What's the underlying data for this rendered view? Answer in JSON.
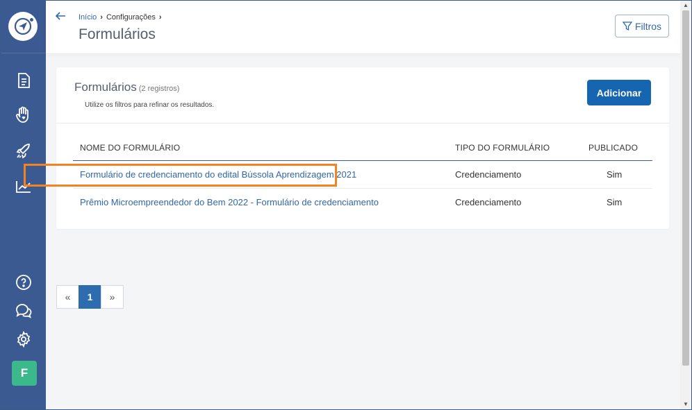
{
  "sidebar": {
    "icons": [
      "compass-logo-icon",
      "document-icon",
      "hand-heart-icon",
      "rocket-icon",
      "chart-icon",
      "help-icon",
      "chat-icon",
      "gear-icon"
    ],
    "avatar_letter": "F",
    "avatar_color": "#3cb98a"
  },
  "header": {
    "breadcrumb": {
      "home": "Início",
      "settings": "Configurações"
    },
    "title": "Formulários",
    "filter_label": "Filtros"
  },
  "card": {
    "title": "Formulários",
    "count": "(2 registros)",
    "subtitle": "Utilize os filtros para refinar os resultados.",
    "add_label": "Adicionar"
  },
  "table": {
    "columns": [
      "NOME DO FORMULÁRIO",
      "TIPO DO FORMULÁRIO",
      "PUBLICADO"
    ],
    "rows": [
      {
        "name": "Formulário de credenciamento do edital Bússola Aprendizagem 2021",
        "type": "Credenciamento",
        "published": "Sim"
      },
      {
        "name": "Prêmio Microempreendedor do Bem 2022 - Formulário de credenciamento",
        "type": "Credenciamento",
        "published": "Sim"
      }
    ]
  },
  "pagination": {
    "prev": "«",
    "current": "1",
    "next": "»"
  },
  "colors": {
    "sidebar": "#3c5a92",
    "accent": "#1565b0",
    "link": "#3167a8",
    "highlight": "#f58220"
  }
}
